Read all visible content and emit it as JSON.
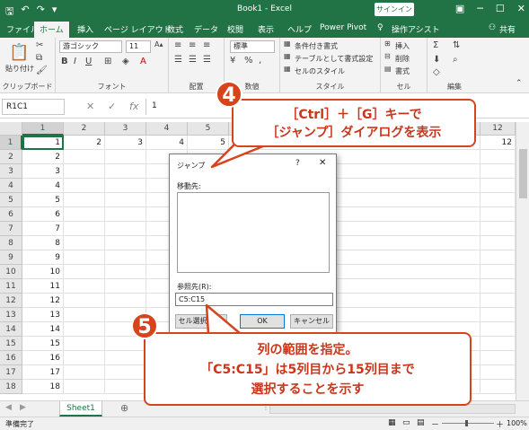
{
  "titlebar": {
    "title": "Book1 - Excel",
    "signin": "サインイン",
    "qa_icons": [
      "save-icon",
      "undo-icon",
      "redo-icon",
      "customize-icon"
    ]
  },
  "tabs": [
    "ファイル",
    "ホーム",
    "挿入",
    "ページ レイアウト",
    "数式",
    "データ",
    "校閲",
    "表示",
    "ヘルプ",
    "Power Pivot",
    "操作アシスト",
    "共有"
  ],
  "ribbon": {
    "paste": "貼り付け",
    "clipboard": "クリップボード",
    "font_name": "游ゴシック",
    "font_size": "11",
    "font_group": "フォント",
    "align_group": "配置",
    "number_format": "標準",
    "number_group": "数値",
    "cond_format": "条件付き書式",
    "table_format": "テーブルとして書式設定",
    "cell_style": "セルのスタイル",
    "style_group": "スタイル",
    "insert": "挿入",
    "delete": "削除",
    "format": "書式",
    "cells_group": "セル",
    "edit_group": "編集"
  },
  "formula": {
    "namebox": "R1C1",
    "value": "1"
  },
  "sheet": {
    "columns": [
      "1",
      "2",
      "3",
      "4",
      "5",
      "12"
    ],
    "rows": [
      "1",
      "2",
      "3",
      "4",
      "5",
      "6",
      "7",
      "8",
      "9",
      "10",
      "11",
      "12",
      "13",
      "14",
      "15",
      "16",
      "17",
      "18"
    ],
    "row1_values": [
      "1",
      "2",
      "3",
      "4",
      "5",
      "12"
    ],
    "col1_values": [
      "1",
      "2",
      "3",
      "4",
      "5",
      "6",
      "7",
      "8",
      "9",
      "10",
      "11",
      "12",
      "13",
      "14",
      "15",
      "16",
      "17",
      "18"
    ]
  },
  "sheetbar": {
    "tab": "Sheet1"
  },
  "status": {
    "ready": "準備完了",
    "zoom": "100%"
  },
  "dialog": {
    "title": "ジャンプ",
    "help": "?",
    "close": "✕",
    "goto_label": "移動先:",
    "ref_label": "参照先(R):",
    "ref_value": "C5:C15",
    "special_btn": "セル選択(S)...",
    "ok_btn": "OK",
    "cancel_btn": "キャンセル"
  },
  "callout4": {
    "number": "4",
    "line1": "［Ctrl］＋［G］キーで",
    "line2": "［ジャンプ］ダイアログを表示"
  },
  "callout5": {
    "number": "5",
    "line1": "列の範囲を指定。",
    "line2": "「C5:C15」は5列目から15列目まで",
    "line3": "選択することを示す"
  },
  "colors": {
    "excel_green": "#217346",
    "callout_red": "#d5441c"
  }
}
